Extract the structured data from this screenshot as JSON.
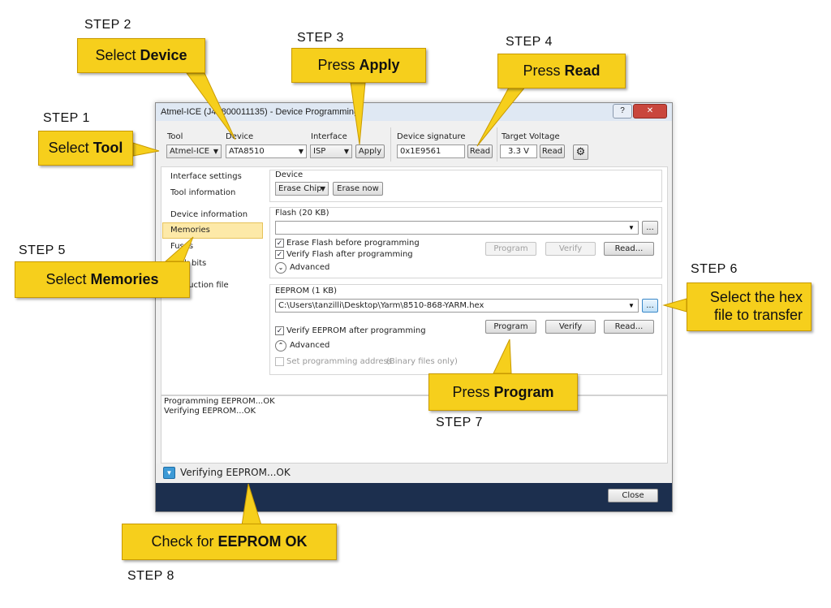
{
  "window": {
    "title": "Atmel-ICE (J41800011135) - Device Programming",
    "help_label": "?",
    "close_label": "✕"
  },
  "toolbar": {
    "tool_label": "Tool",
    "tool_value": "Atmel-ICE",
    "device_label": "Device",
    "device_value": "ATA8510",
    "interface_label": "Interface",
    "interface_value": "ISP",
    "apply_label": "Apply",
    "signature_label": "Device signature",
    "signature_value": "0x1E9561",
    "read_label": "Read",
    "voltage_label": "Target Voltage",
    "voltage_value": "3.3 V",
    "voltage_read_label": "Read"
  },
  "sidebar": {
    "items": [
      {
        "label": "Interface settings"
      },
      {
        "label": "Tool information"
      },
      {
        "label": "Device information"
      },
      {
        "label": "Memories"
      },
      {
        "label": "Fuses"
      },
      {
        "label": "Lock bits"
      },
      {
        "label": "Production file"
      }
    ]
  },
  "device_panel": {
    "heading": "Device",
    "erase_value": "Erase Chip",
    "erase_now_label": "Erase now"
  },
  "flash_panel": {
    "heading": "Flash (20 KB)",
    "path": "",
    "browse_label": "...",
    "erase_before_label": "Erase Flash before programming",
    "verify_after_label": "Verify Flash after programming",
    "advanced_label": "Advanced",
    "program_label": "Program",
    "verify_label": "Verify",
    "read_label": "Read..."
  },
  "eeprom_panel": {
    "heading": "EEPROM (1 KB)",
    "path": "C:\\Users\\tanzilli\\Desktop\\Yarm\\8510-868-YARM.hex",
    "browse_label": "...",
    "verify_after_label": "Verify EEPROM after programming",
    "advanced_label": "Advanced",
    "set_address_label": "Set programming address",
    "set_address_note": "(Binary files only)",
    "program_label": "Program",
    "verify_label": "Verify",
    "read_label": "Read..."
  },
  "log": {
    "line1": "Programming EEPROM...OK",
    "line2": "Verifying EEPROM...OK"
  },
  "status": {
    "text": "Verifying EEPROM...OK",
    "close_label": "Close"
  },
  "steps": {
    "s1": "STEP 1",
    "s2": "STEP 2",
    "s3": "STEP 3",
    "s4": "STEP 4",
    "s5": "STEP 5",
    "s6": "STEP 6",
    "s7": "STEP 7",
    "s8": "STEP 8"
  },
  "callouts": {
    "c1": {
      "pre": "Select ",
      "bold": "Tool",
      "post": ""
    },
    "c2": {
      "pre": "Select  ",
      "bold": "Device",
      "post": ""
    },
    "c3": {
      "pre": "Press ",
      "bold": "Apply",
      "post": ""
    },
    "c4": {
      "pre": "Press ",
      "bold": "Read",
      "post": ""
    },
    "c5": {
      "pre": "Select ",
      "bold": "Memories",
      "post": ""
    },
    "c6": {
      "line1": "Select the hex",
      "line2": "file to transfer"
    },
    "c7": {
      "pre": "Press ",
      "bold": "Program",
      "post": ""
    },
    "c8": {
      "pre": "Check for ",
      "bold": "EEPROM OK",
      "post": ""
    }
  },
  "colors": {
    "callout": "#f6cf1c",
    "selected_item": "#fde9a8",
    "status_blue": "#1c2f4e"
  }
}
